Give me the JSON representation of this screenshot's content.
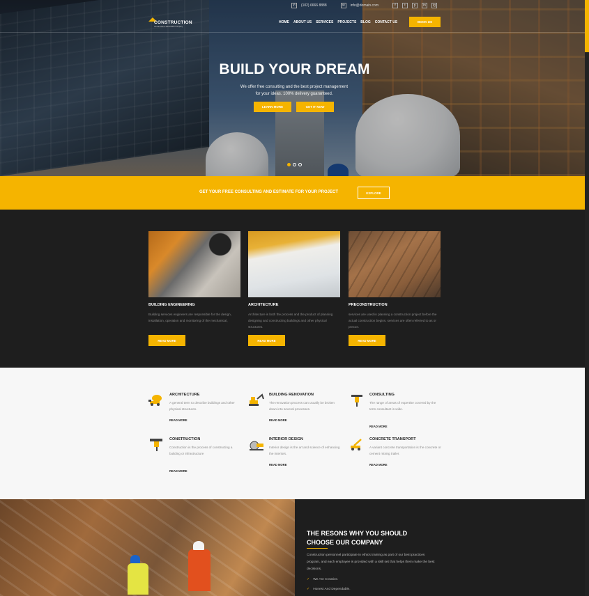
{
  "colors": {
    "accent": "#f5b400",
    "dark": "#1e1e1e",
    "light": "#f7f7f7"
  },
  "topbar": {
    "phone_icon": "phone-icon",
    "phone": "(102) 6666 8888",
    "mail_icon": "mail-icon",
    "email": "info@domain.com",
    "social": [
      "f",
      "t",
      "p",
      "in",
      "ig"
    ]
  },
  "logo": {
    "name": "CONSTRUCTION",
    "tagline": "Construction & Renovation Company"
  },
  "nav": {
    "items": [
      "HOME",
      "ABOUT US",
      "SERVICES",
      "PROJECTS",
      "BLOG",
      "CONTACT US"
    ],
    "book": "BOOK US"
  },
  "hero": {
    "title": "BUILD YOUR DREAM",
    "subtitle_line1": "We offer free consulting and the best project management",
    "subtitle_line2": "for your ideas. 100% delivery guaranteed.",
    "learn_more": "LEARN MORE",
    "get_it_now": "GET IT NOW"
  },
  "cta": {
    "text": "GET YOUR FREE CONSULTING AND ESTIMATE FOR YOUR PROJECT",
    "button": "EXPLORE"
  },
  "services": [
    {
      "title": "BUILDING ENGINEERING",
      "text": "Building services engineers are responsible for the design, installation, operation and monitoring of the mechanical,",
      "button": "READ MORE"
    },
    {
      "title": "ARCHITECTURE",
      "text": "Architecture is both the process and the product of planning designing and constructing buildings and other physical structures.",
      "button": "READ MORE"
    },
    {
      "title": "PRECONSTRUCTION",
      "text": "services are used in planning a construction project before the actual construction begins. services are often referred to as or precon.",
      "button": "READ MORE"
    }
  ],
  "features": [
    {
      "title": "ARCHITECTURE",
      "text": "A general term to describe buildings and other physical structures.",
      "link": "READ MORE",
      "icon": "concrete-mixer-icon"
    },
    {
      "title": "BUILDING RENOVATION",
      "text": "The renovation process can usually be broken down into several processes.",
      "link": "READ MORE",
      "icon": "excavator-icon"
    },
    {
      "title": "CONSULTING",
      "text": "The range of areas of expertise covered by the term consultant is wide.",
      "link": "READ MORE",
      "icon": "jackhammer-icon"
    },
    {
      "title": "CONSTRUCTION",
      "text": "Construction is the process of constructing a building or infrastructure",
      "link": "READ MORE",
      "icon": "drill-icon"
    },
    {
      "title": "INTERIOR DESIGN",
      "text": "Interior design is the art and science of enhancing the interiors.",
      "link": "READ MORE",
      "icon": "saw-icon"
    },
    {
      "title": "CONCRETE TRANSPORT",
      "text": "A variant concrete transportation is the concrete or cement mixing trailer.",
      "link": "READ MORE",
      "icon": "crane-truck-icon"
    }
  ],
  "reasons": {
    "title_line1": "THE RESONS WHY YOU SHOULD",
    "title_line2": "CHOOSE OUR COMPANY",
    "text": "Construction personnel participate in ethics training as part of our best practices program, and each employee is provided with a skill set that helps them make the best decisions.",
    "items": [
      "We Are Creative.",
      "Honest And Dependable."
    ]
  }
}
